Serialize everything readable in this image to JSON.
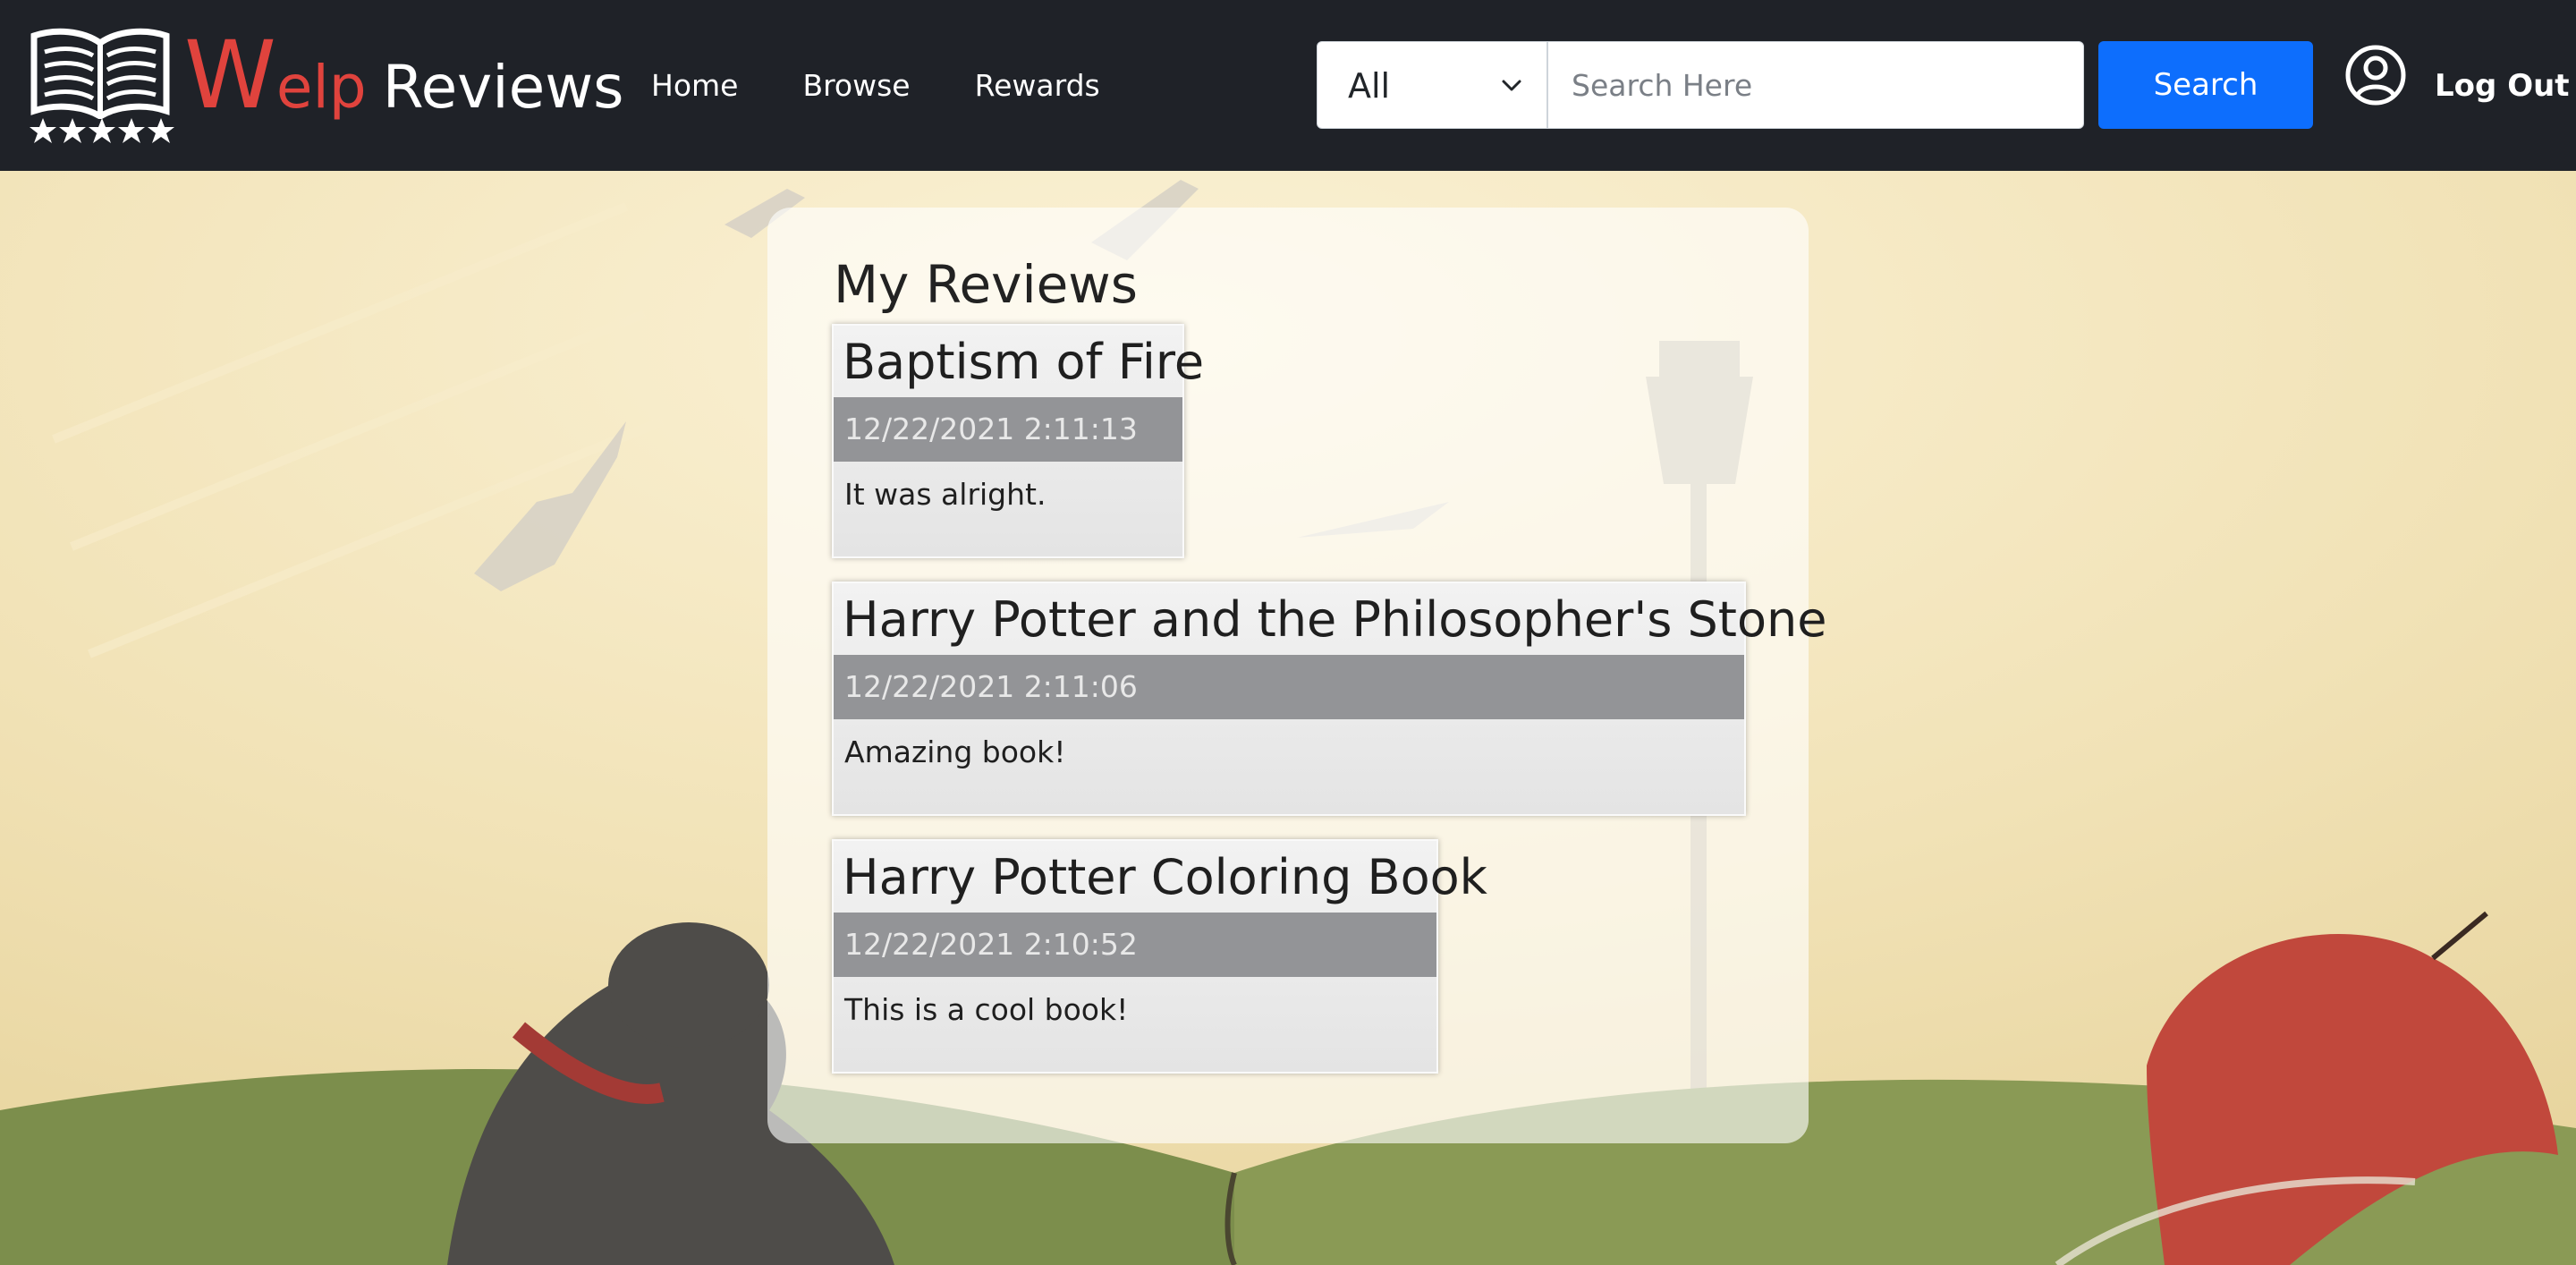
{
  "brand": {
    "logo_first_letter": "W",
    "logo_rest": "elp",
    "logo_second_word": "Reviews",
    "accent_color": "#e0433d"
  },
  "nav": {
    "links": [
      "Home",
      "Browse",
      "Rewards"
    ]
  },
  "search": {
    "category_value": "All",
    "placeholder": "Search Here",
    "button_label": "Search",
    "button_color": "#0d6efd"
  },
  "user": {
    "icon": "user-circle-icon",
    "logout_label": "Log Out"
  },
  "main": {
    "title": "My Reviews",
    "reviews": [
      {
        "book_title": "Baptism of Fire",
        "timestamp": "12/22/2021 2:11:13",
        "text": "It was alright."
      },
      {
        "book_title": "Harry Potter and the Philosopher's Stone",
        "timestamp": "12/22/2021 2:11:06",
        "text": "Amazing book!"
      },
      {
        "book_title": "Harry Potter Coloring Book",
        "timestamp": "12/22/2021 2:10:52",
        "text": "This is a cool book!"
      }
    ]
  }
}
